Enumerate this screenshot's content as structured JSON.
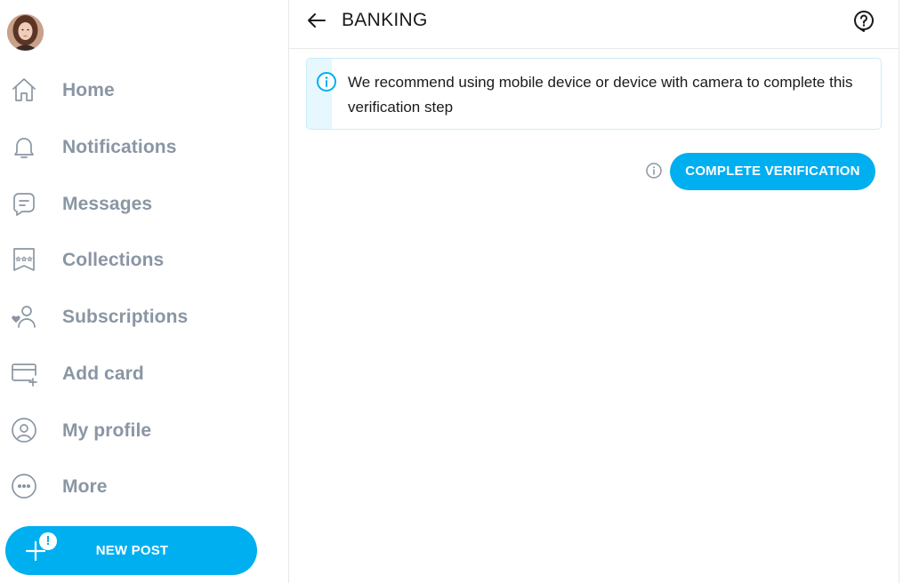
{
  "sidebar": {
    "avatar_icon": "user-avatar",
    "items": [
      {
        "label": "Home",
        "icon": "home-icon"
      },
      {
        "label": "Notifications",
        "icon": "bell-icon"
      },
      {
        "label": "Messages",
        "icon": "message-icon"
      },
      {
        "label": "Collections",
        "icon": "bookmark-stars-icon"
      },
      {
        "label": "Subscriptions",
        "icon": "user-heart-icon"
      },
      {
        "label": "Add card",
        "icon": "card-plus-icon"
      },
      {
        "label": "My profile",
        "icon": "profile-circle-icon"
      },
      {
        "label": "More",
        "icon": "more-dots-icon"
      }
    ],
    "new_post": {
      "label": "NEW POST",
      "badge": "!"
    }
  },
  "header": {
    "title": "BANKING",
    "back_icon": "arrow-left-icon",
    "help_icon": "question-icon"
  },
  "notice": {
    "text": "We recommend using mobile device or device with camera to complete this verification step",
    "icon": "info-icon"
  },
  "verification": {
    "button_label": "COMPLETE VERIFICATION",
    "info_icon": "info-icon"
  },
  "colors": {
    "accent": "#00aff0",
    "nav_text": "#8a96a3",
    "notice_bg": "#e6f7fe"
  }
}
